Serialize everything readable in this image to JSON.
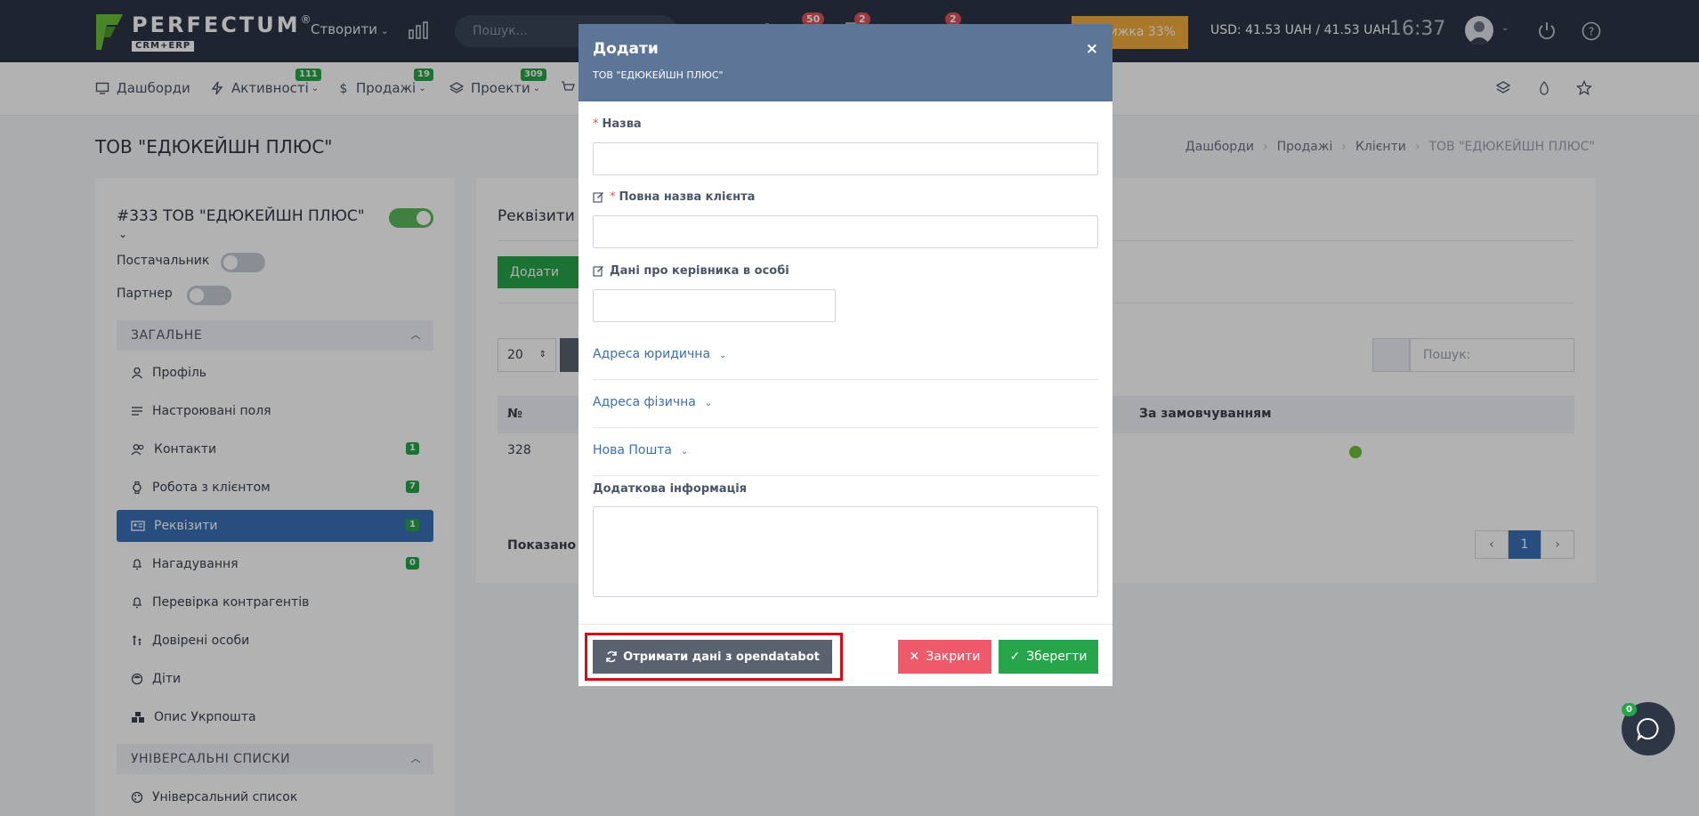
{
  "header": {
    "logo_word": "PERFECTUM",
    "logo_reg": "®",
    "logo_sub": "CRM+ERP",
    "create_label": "Створити",
    "search_placeholder": "Пошук...",
    "badges": [
      "50",
      "2",
      "2"
    ],
    "promo_label": "Знижка 33%",
    "currency": "USD: 41.53 UAH / 41.53 UAH",
    "clock": "16:37"
  },
  "nav": {
    "items": [
      {
        "label": "Дашборди",
        "badge": ""
      },
      {
        "label": "Активності",
        "badge": "111"
      },
      {
        "label": "Продажі",
        "badge": "19"
      },
      {
        "label": "Проекти",
        "badge": "309"
      }
    ]
  },
  "page": {
    "title": "ТОВ \"ЕДЮКЕЙШН ПЛЮС\"",
    "breadcrumb": [
      "Дашборди",
      "Продажі",
      "Клієнти",
      "ТОВ \"ЕДЮКЕЙШН ПЛЮС\""
    ]
  },
  "left_card": {
    "client_name": "#333 ТОВ \"ЕДЮКЕЙШН ПЛЮС\"",
    "supplier_label": "Постачальник",
    "partner_label": "Партнер",
    "section_general": "ЗАГАЛЬНЕ",
    "section_universal": "УНІВЕРСАЛЬНІ СПИСКИ",
    "menu": [
      {
        "label": "Профіль",
        "badge": ""
      },
      {
        "label": "Настроювані поля",
        "badge": ""
      },
      {
        "label": "Контакти",
        "badge": "1"
      },
      {
        "label": "Робота з клієнтом",
        "badge": "7"
      },
      {
        "label": "Реквізити",
        "badge": "1"
      },
      {
        "label": "Нагадування",
        "badge": "0"
      },
      {
        "label": "Перевірка контрагентів",
        "badge": ""
      },
      {
        "label": "Довірені особи",
        "badge": ""
      },
      {
        "label": "Діти",
        "badge": ""
      },
      {
        "label": "Опис Укрпошта",
        "badge": ""
      }
    ],
    "universal_menu": [
      {
        "label": "Універсальний список"
      }
    ]
  },
  "right_card": {
    "title": "Реквізити",
    "add_label": "Додати",
    "page_size": "20",
    "search_placeholder": "Пошук:",
    "col_no": "№",
    "col_default": "За замовчуванням",
    "row_no": "328",
    "shown_label": "Показано 1",
    "prev": "‹",
    "page": "1",
    "next": "›"
  },
  "modal": {
    "title": "Додати",
    "subtitle": "ТОВ \"ЕДЮКЕЙШН ПЛЮС\"",
    "close_glyph": "×",
    "field_name": "Назва",
    "field_full_name": "Повна назва клієнта",
    "field_director": "Дані про керівника в особі",
    "legal_address": "Адреса юридична",
    "physical_address": "Адреса фізична",
    "nova_poshta": "Нова Пошта",
    "extra_info": "Додаткова інформація",
    "opendatabot_label": "Отримати дані з opendatabot",
    "close_label": "Закрити",
    "save_label": "Зберегти"
  },
  "chat": {
    "badge": "0"
  },
  "colors": {
    "header_bg": "#2c3645",
    "modal_header": "#5d7698",
    "accent_blue": "#3a6fb7",
    "success": "#27a54a",
    "danger": "#ef5a6b",
    "highlight": "#d40d19"
  }
}
